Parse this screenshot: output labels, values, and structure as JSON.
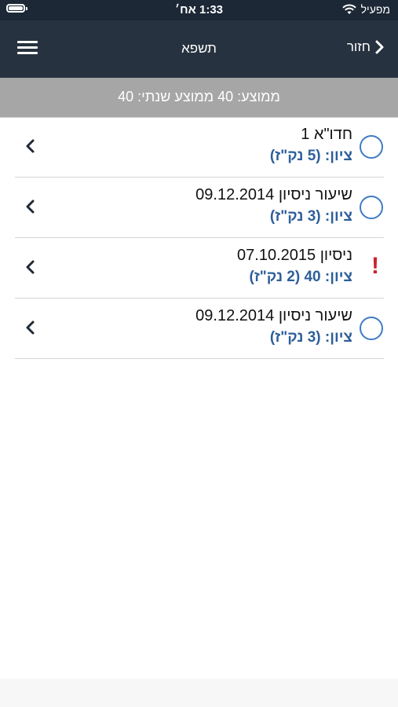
{
  "status_bar": {
    "time": "1:33 אח׳",
    "carrier": "מפעיל",
    "icons": [
      "battery-icon",
      "wifi-icon"
    ]
  },
  "header": {
    "title": "תשפא",
    "back_label": "חזור",
    "icons": [
      "chevron-right-icon",
      "hamburger-menu-icon"
    ]
  },
  "summary": {
    "text": "ממוצע: 40 ממוצע שנתי: 40"
  },
  "items": [
    {
      "title": "חדו\"א 1",
      "grade": "ציון: (5 נק\"ז)",
      "status": "circle-icon"
    },
    {
      "title": "שיעור ניסיון 09.12.2014",
      "grade": "ציון: (3 נק\"ז)",
      "status": "circle-icon"
    },
    {
      "title": "ניסיון 07.10.2015",
      "grade": "ציון: 40 (2 נק\"ז)",
      "status": "alert-icon"
    },
    {
      "title": "שיעור ניסיון 09.12.2014",
      "grade": "ציון: (3 נק\"ז)",
      "status": "circle-icon"
    }
  ],
  "colors": {
    "nav_background": "#26323f",
    "status_background": "#1c2836",
    "summary_background": "#a6a6a6",
    "grade_text": "#2e5e9a",
    "circle_stroke": "#3f7bc6",
    "alert": "#d0202f"
  }
}
